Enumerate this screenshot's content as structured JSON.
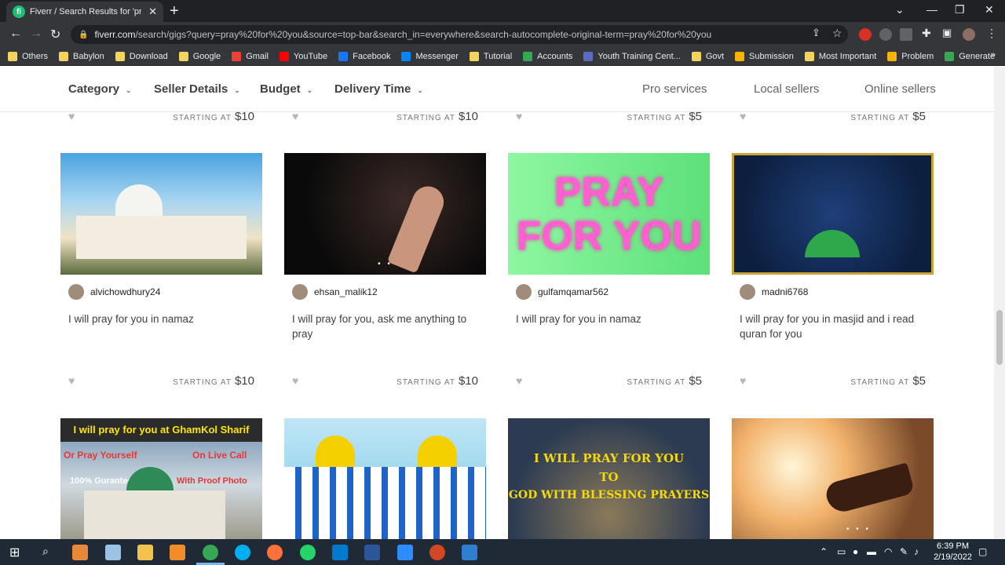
{
  "browser": {
    "tab_title": "Fiverr / Search Results for 'pray fo",
    "tab_favicon": "fi",
    "url_host": "fiverr.com",
    "url_path": "/search/gigs?query=pray%20for%20you&source=top-bar&search_in=everywhere&search-autocomplete-original-term=pray%20for%20you",
    "bookmarks": [
      {
        "label": "Others",
        "icon": "folder-icon",
        "color": "#f4d35e"
      },
      {
        "label": "Babylon",
        "icon": "folder-icon",
        "color": "#f4d35e"
      },
      {
        "label": "Download",
        "icon": "folder-icon",
        "color": "#f4d35e"
      },
      {
        "label": "Google",
        "icon": "folder-icon",
        "color": "#f4d35e"
      },
      {
        "label": "Gmail",
        "icon": "gmail-icon",
        "color": "#ea4335"
      },
      {
        "label": "YouTube",
        "icon": "youtube-icon",
        "color": "#ff0000"
      },
      {
        "label": "Facebook",
        "icon": "facebook-icon",
        "color": "#1877f2"
      },
      {
        "label": "Messenger",
        "icon": "messenger-icon",
        "color": "#0084ff"
      },
      {
        "label": "Tutorial",
        "icon": "folder-icon",
        "color": "#f4d35e"
      },
      {
        "label": "Accounts",
        "icon": "drive-icon",
        "color": "#34a853"
      },
      {
        "label": "Youth Training Cent...",
        "icon": "site-icon",
        "color": "#5c6bc0"
      },
      {
        "label": "Govt",
        "icon": "folder-icon",
        "color": "#f4d35e"
      },
      {
        "label": "Submission",
        "icon": "trophy-icon",
        "color": "#f4b400"
      },
      {
        "label": "Most Important",
        "icon": "folder-icon",
        "color": "#f4d35e"
      },
      {
        "label": "Problem",
        "icon": "trophy-icon",
        "color": "#f4b400"
      },
      {
        "label": "Generate",
        "icon": "link-icon",
        "color": "#34a853"
      }
    ],
    "more_bookmarks": "»"
  },
  "filters": {
    "category": "Category",
    "seller_details": "Seller Details",
    "budget": "Budget",
    "delivery_time": "Delivery Time",
    "pro_services": "Pro services",
    "local_sellers": "Local sellers",
    "online_sellers": "Online sellers"
  },
  "starting_at_label": "STARTING AT",
  "top_row_prices": [
    "$10",
    "$10",
    "$5",
    "$5"
  ],
  "gigs": [
    {
      "seller": "alvichowdhury24",
      "title": "I will pray for you in namaz",
      "price": "$10",
      "thumb_icon": "mosque-image-icon"
    },
    {
      "seller": "ehsan_malik12",
      "title": "I will pray for you, ask me anything to pray",
      "price": "$10",
      "thumb_icon": "praying-hands-image-icon"
    },
    {
      "seller": "gulfamqamar562",
      "title": "I will pray for you in namaz",
      "price": "$5",
      "thumb_text": "PRAY FOR YOU"
    },
    {
      "seller": "madni6768",
      "title": "I will pray for you in masjid and i read quran for you",
      "price": "$5",
      "thumb_icon": "quran-image-icon"
    }
  ],
  "bottom_thumbs": [
    {
      "line1": "I will pray for you at GhamKol Sharif",
      "line2a": "Or Pray Yourself",
      "line2b": "On Live Call",
      "line3a": "100% Guranteed",
      "line3b": "With Proof Photo"
    },
    {
      "icon": "colorful-mosque-image-icon"
    },
    {
      "line1": "I WILL PRAY FOR YOU",
      "line2": "TO",
      "line3": "GOD WITH BLESSING PRAYERS"
    },
    {
      "icon": "sunset-hands-image-icon"
    }
  ],
  "taskbar": {
    "time": "6:39 PM",
    "date": "2/19/2022"
  }
}
